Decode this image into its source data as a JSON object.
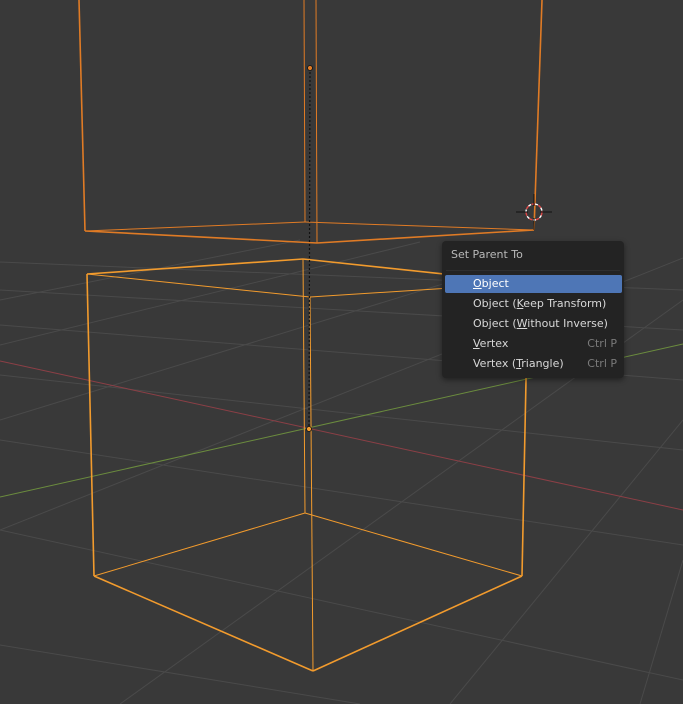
{
  "viewport": {
    "background": "#393939",
    "colors": {
      "grid": "#4a4a4a",
      "x_axis": "#8c3f46",
      "y_axis": "#6b8c3e",
      "active_object": "#e07b25",
      "selected_object": "#f29b2d",
      "parent_line": "#111111",
      "cursor": "#e04646"
    },
    "icons": {
      "cursor": "3d-cursor-icon",
      "origin": "object-origin-icon"
    }
  },
  "menu": {
    "title": "Set Parent To",
    "items": [
      {
        "before": "",
        "key": "O",
        "after": "bject",
        "shortcut": "",
        "active": true
      },
      {
        "before": "Object (",
        "key": "K",
        "after": "eep Transform)",
        "shortcut": "",
        "active": false
      },
      {
        "before": "Object (",
        "key": "W",
        "after": "ithout Inverse)",
        "shortcut": "",
        "active": false
      },
      {
        "before": "",
        "key": "V",
        "after": "ertex",
        "shortcut": "Ctrl P",
        "active": false
      },
      {
        "before": "Vertex (",
        "key": "T",
        "after": "riangle)",
        "shortcut": "Ctrl P",
        "active": false
      }
    ]
  }
}
